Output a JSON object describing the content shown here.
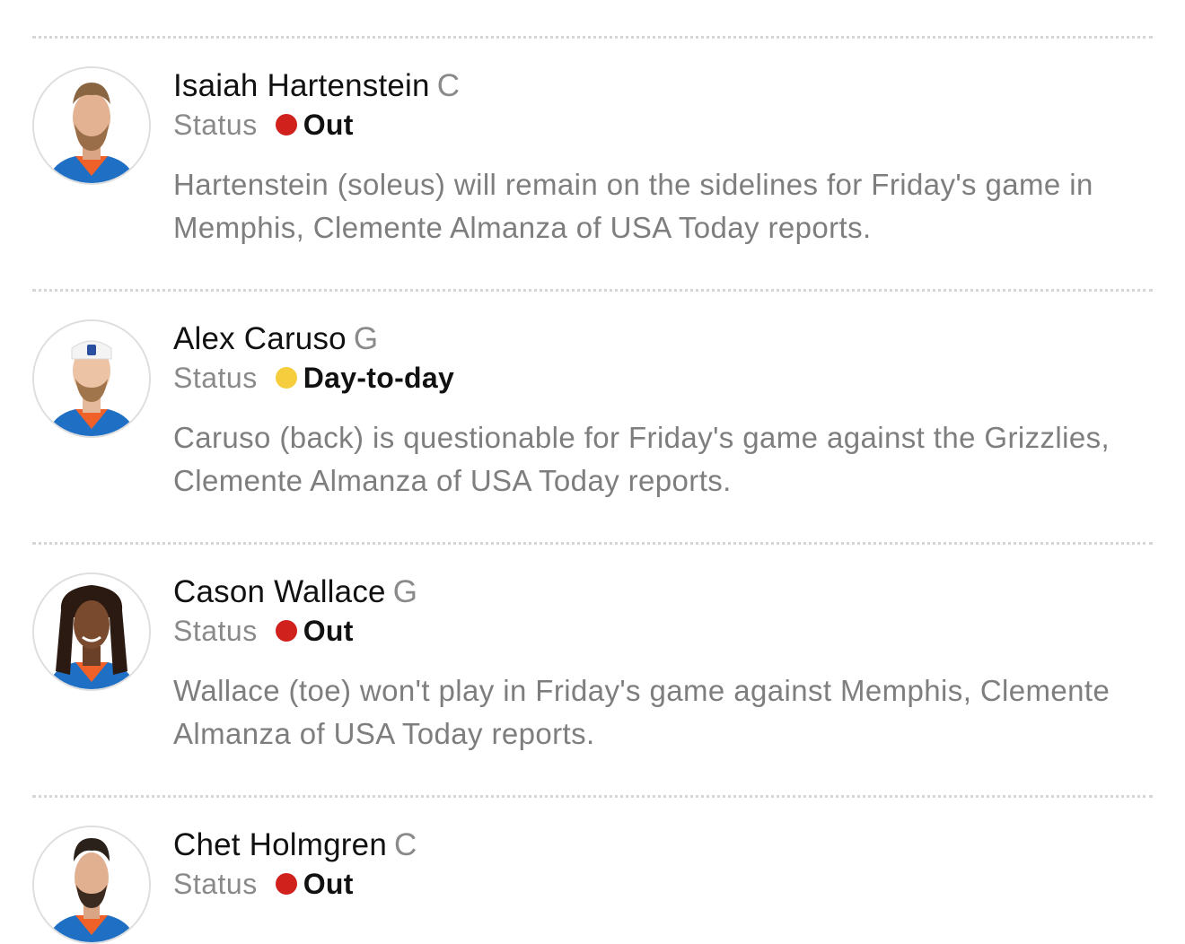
{
  "injuries": [
    {
      "name": "Isaiah Hartenstein",
      "position": "C",
      "status_label": "Status",
      "status": "Out",
      "status_color": "#d0211c",
      "note": "Hartenstein (soleus) will remain on the sidelines for Friday's game in Memphis, Clemente Almanza of USA Today reports.",
      "avatar_icon": "player-headshot-icon"
    },
    {
      "name": "Alex Caruso",
      "position": "G",
      "status_label": "Status",
      "status": "Day-to-day",
      "status_color": "#f5cd3d",
      "note": "Caruso (back) is questionable for Friday's game against the Grizzlies, Clemente Almanza of USA Today reports.",
      "avatar_icon": "player-headshot-icon"
    },
    {
      "name": "Cason Wallace",
      "position": "G",
      "status_label": "Status",
      "status": "Out",
      "status_color": "#d0211c",
      "note": "Wallace (toe) won't play in Friday's game against Memphis, Clemente Almanza of USA Today reports.",
      "avatar_icon": "player-headshot-icon"
    },
    {
      "name": "Chet Holmgren",
      "position": "C",
      "status_label": "Status",
      "status": "Out",
      "status_color": "#d0211c",
      "note": "",
      "avatar_icon": "player-headshot-icon"
    }
  ],
  "colors": {
    "jersey_blue": "#1f6fc4",
    "jersey_orange": "#f0612a"
  }
}
